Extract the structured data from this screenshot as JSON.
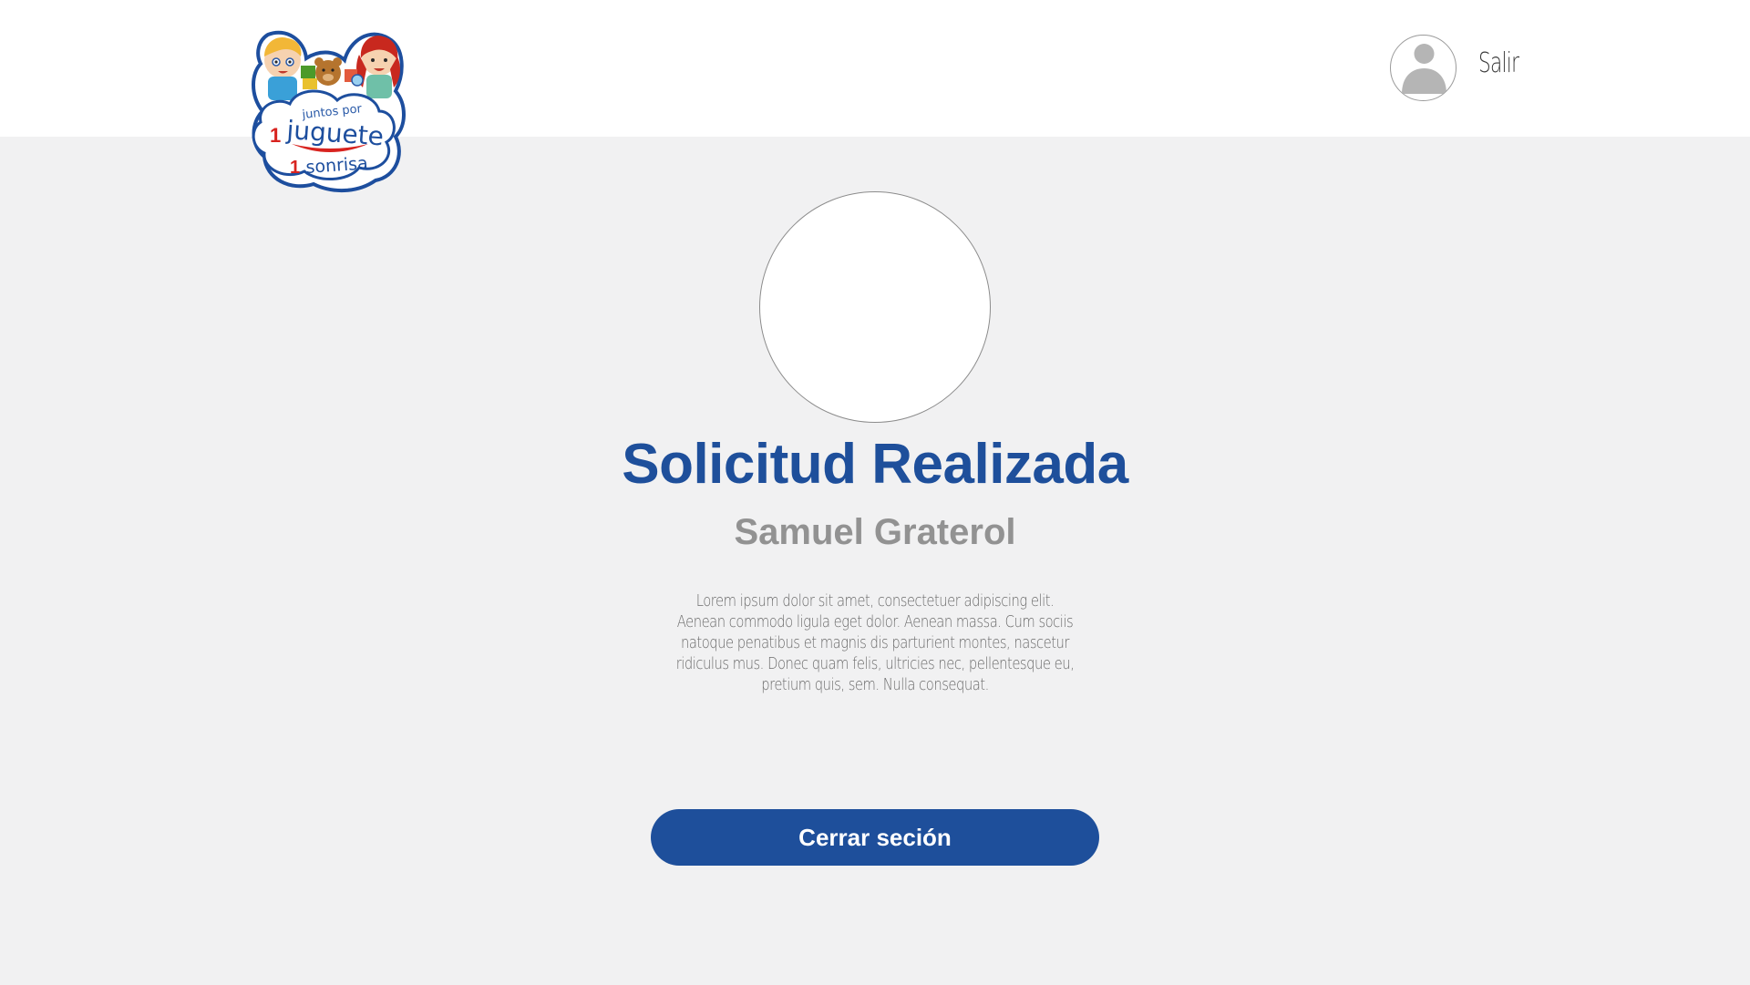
{
  "header": {
    "logo": {
      "alt_text": "juntos por 1 juguete 1 sonrisa",
      "line1": "juntos por",
      "num1": "1",
      "word1": "juguete",
      "num2": "1",
      "word2": "sonrisa"
    },
    "user": {
      "avatar_icon": "user-silhouette-icon",
      "logout_label": "Salir"
    }
  },
  "main": {
    "title": "Solicitud Realizada",
    "name": "Samuel Graterol",
    "description": "Lorem ipsum dolor sit amet, consectetuer adipiscing elit. Aenean commodo ligula eget dolor. Aenean massa. Cum sociis natoque penatibus et magnis dis parturient montes, nascetur ridiculus mus. Donec quam felis, ultricies nec, pellentesque eu, pretium quis, sem. Nulla consequat.",
    "close_button_label": "Cerrar seción"
  },
  "colors": {
    "primary": "#1e4f9b",
    "background": "#f1f1f2",
    "header_bg": "#ffffff",
    "name_gray": "#929292",
    "logo_red": "#d8231f"
  }
}
